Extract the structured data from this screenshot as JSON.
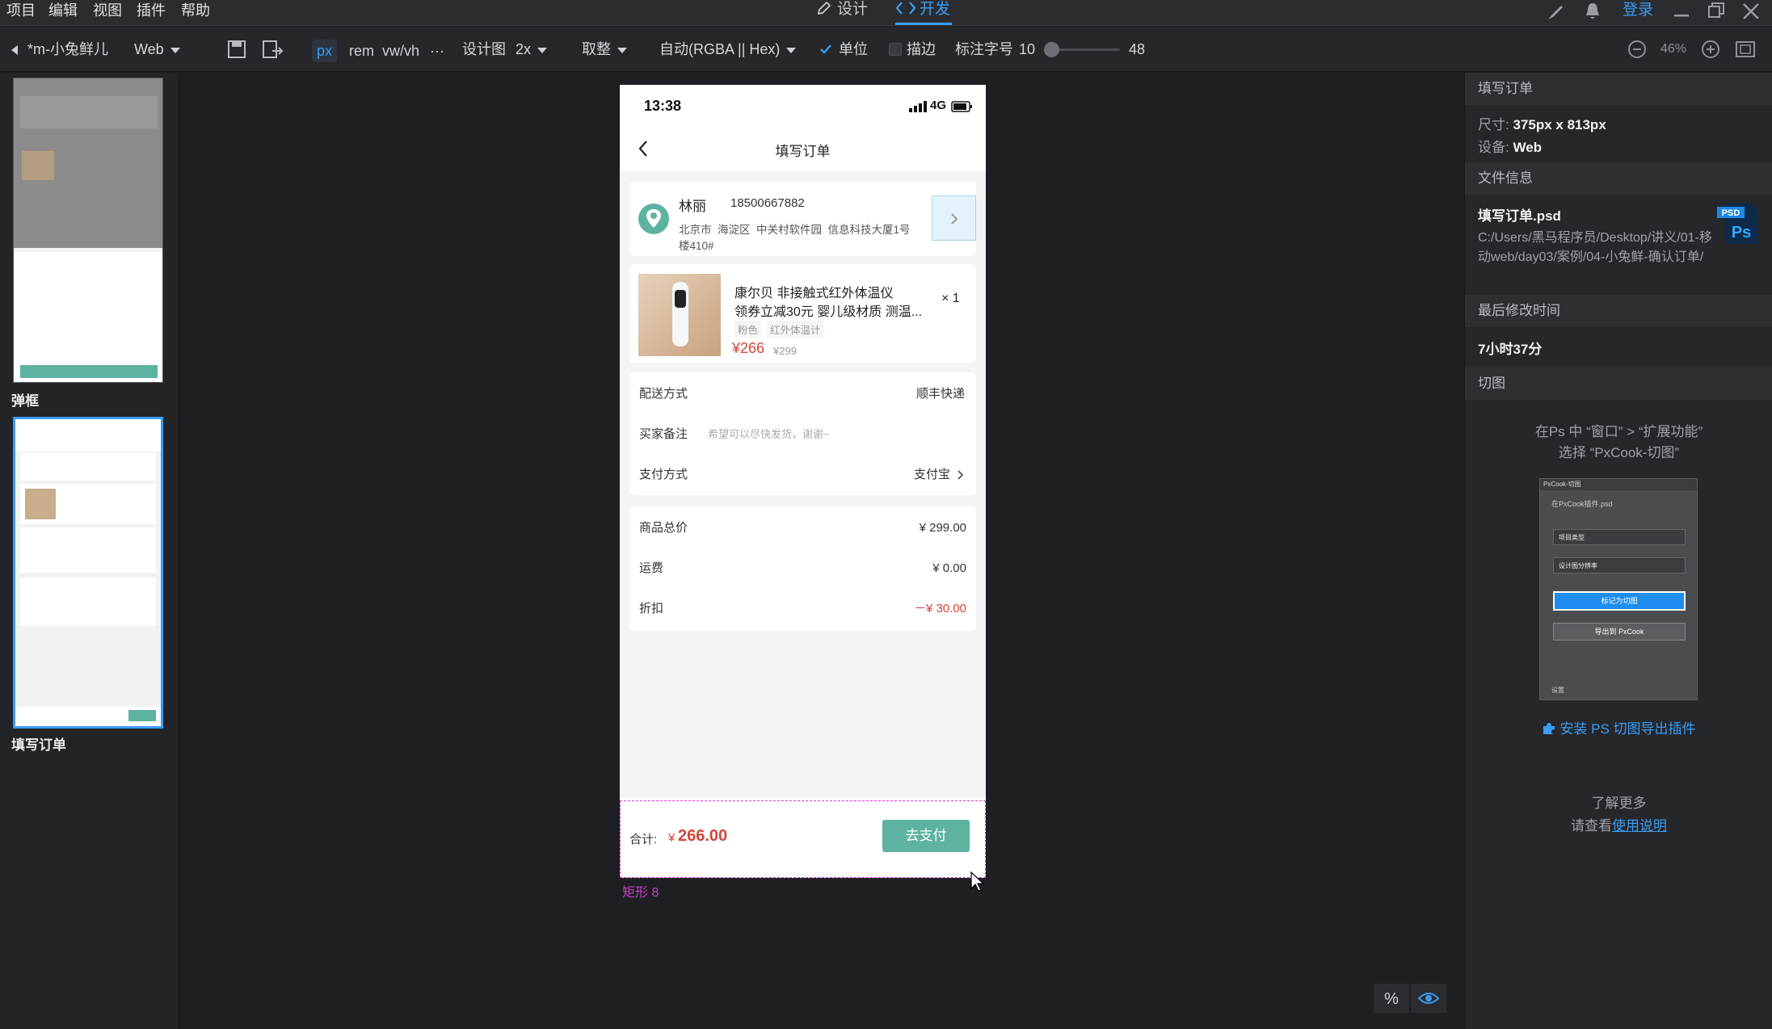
{
  "menu": {
    "items": [
      "项目",
      "编辑",
      "视图",
      "插件",
      "帮助"
    ],
    "tabs": [
      {
        "label": "设计",
        "active": false
      },
      {
        "label": "开发",
        "active": true
      }
    ],
    "login_label": "登录"
  },
  "toolbar": {
    "project_name": "*m-小兔鲜儿",
    "platform": "Web",
    "units": [
      "px",
      "rem",
      "vw/vh",
      "···"
    ],
    "active_unit": "px",
    "design_label": "设计图",
    "design_scale": "2x",
    "rounding": "取整",
    "color_format": "自动(RGBA || Hex)",
    "unit_label": "单位",
    "unit_checked": true,
    "stroke_label": "描边",
    "stroke_checked": false,
    "font_size_label": "标注字号",
    "font_size_min": "10",
    "font_size_max": "48",
    "zoom": "46%"
  },
  "left_panel": {
    "artboards": [
      {
        "label": "弹框",
        "selected": false
      },
      {
        "label": "填写订单",
        "selected": true
      }
    ]
  },
  "phone": {
    "time": "13:38",
    "network": "4G",
    "nav_title": "填写订单",
    "address": {
      "name": "林丽",
      "phone": "18500667882",
      "line1": "北京市  海淀区  中关村软件园  信息科技大厦1号",
      "line2": "楼410#"
    },
    "product": {
      "title_line1": "康尔贝 非接触式红外体温仪",
      "title_line2": "领券立减30元 婴儿级材质 测温...",
      "tags": [
        "粉色",
        "红外体温计"
      ],
      "price": "¥266",
      "original_price": "¥299",
      "quantity": "× 1"
    },
    "options": [
      {
        "label": "配送方式",
        "value": "顺丰快递",
        "arrow": false
      },
      {
        "label": "买家备注",
        "placeholder": "希望可以尽快发货，谢谢~"
      },
      {
        "label": "支付方式",
        "value": "支付宝",
        "arrow": true
      }
    ],
    "summary": [
      {
        "label": "商品总价",
        "value": "¥ 299.00",
        "highlight": false
      },
      {
        "label": "运费",
        "value": "¥ 0.00",
        "highlight": false
      },
      {
        "label": "折扣",
        "value": "－¥ 30.00",
        "highlight": true
      }
    ],
    "footer": {
      "total_label": "合计:",
      "total_currency": "¥",
      "total_value": "266.00",
      "pay_button": "去支付"
    }
  },
  "selection": {
    "layer_name": "矩形 8"
  },
  "right_panel": {
    "title": "填写订单",
    "size_label": "尺寸:",
    "size_value": "375px x 813px",
    "device_label": "设备:",
    "device_value": "Web",
    "file_info_header": "文件信息",
    "file_name": "填写订单.psd",
    "file_path": "C:/Users/黑马程序员/Desktop/讲义/01-移动web/day03/案例/04-小兔鲜-确认订单/",
    "modified_header": "最后修改时间",
    "modified_value": "7小时37分",
    "slice_header": "切图",
    "slice_hint_line1": "在Ps 中 “窗口” > “扩展功能”",
    "slice_hint_line2": "选择 “PxCook-切图”",
    "plugin_preview": {
      "title": "PxCook-切图",
      "file": "在PxCook插件.psd",
      "select1": "项目类型",
      "select2": "设计图分辨率",
      "btn1": "标记为切图",
      "btn2": "导出到 PxCook",
      "settings": "设置"
    },
    "install_link": "安装 PS 切图导出插件",
    "learn_more": "了解更多",
    "see_label": "请查看",
    "usage_link": "使用说明"
  },
  "colors": {
    "accent_blue": "#3a9cf4",
    "brand_green": "#5eb3a0",
    "price_red": "#d4443a",
    "selection_magenta": "#d63ad6"
  }
}
